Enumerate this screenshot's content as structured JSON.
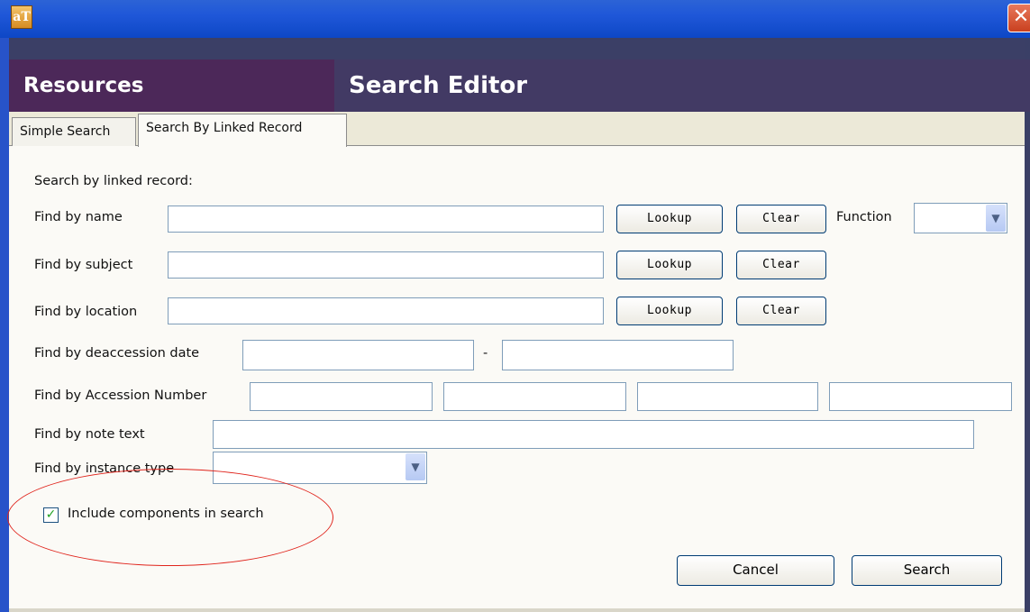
{
  "window": {
    "close_glyph": "✕",
    "icon": "aT"
  },
  "header": {
    "left_title": "Resources",
    "right_title": "Search Editor"
  },
  "tabs": [
    {
      "label": "Simple Search"
    },
    {
      "label": "Search By Linked Record"
    }
  ],
  "form": {
    "heading": "Search by linked record:",
    "name_label": "Find by name",
    "subject_label": "Find by subject",
    "location_label": "Find by location",
    "deaccession_label": "Find by deaccession date",
    "date_separator": "-",
    "accession_label": "Find by Accession Number",
    "note_label": "Find by note text",
    "instance_label": "Find by instance type",
    "function_label": "Function",
    "lookup_label": "Lookup",
    "clear_label": "Clear",
    "include_components_label": "Include components in search",
    "include_components_checked": true
  },
  "actions": {
    "cancel_label": "Cancel",
    "search_label": "Search"
  }
}
